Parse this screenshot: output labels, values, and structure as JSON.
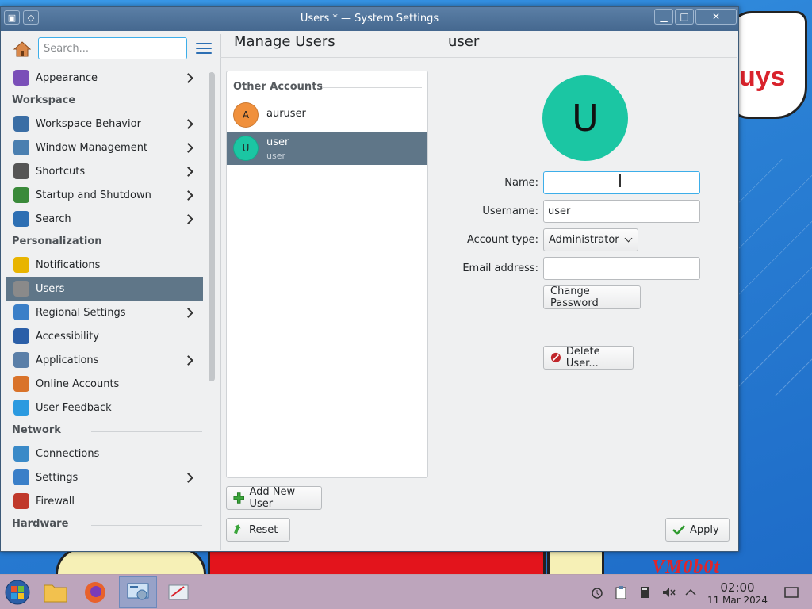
{
  "window": {
    "title": "Users * — System Settings",
    "controls": {
      "minimize": "▁",
      "maximize": "□",
      "close": "✕"
    }
  },
  "sidebar": {
    "search_placeholder": "Search...",
    "top_item": {
      "label": "Appearance",
      "has_children": true
    },
    "categories": [
      {
        "title": "Workspace",
        "items": [
          {
            "label": "Workspace Behavior",
            "has_children": true
          },
          {
            "label": "Window Management",
            "has_children": true
          },
          {
            "label": "Shortcuts",
            "has_children": true
          },
          {
            "label": "Startup and Shutdown",
            "has_children": true
          },
          {
            "label": "Search",
            "has_children": true
          }
        ]
      },
      {
        "title": "Personalization",
        "items": [
          {
            "label": "Notifications",
            "has_children": false
          },
          {
            "label": "Users",
            "has_children": false,
            "selected": true
          },
          {
            "label": "Regional Settings",
            "has_children": true
          },
          {
            "label": "Accessibility",
            "has_children": false
          },
          {
            "label": "Applications",
            "has_children": true
          },
          {
            "label": "Online Accounts",
            "has_children": false
          },
          {
            "label": "User Feedback",
            "has_children": false
          }
        ]
      },
      {
        "title": "Network",
        "items": [
          {
            "label": "Connections",
            "has_children": false
          },
          {
            "label": "Settings",
            "has_children": true
          },
          {
            "label": "Firewall",
            "has_children": false
          }
        ]
      },
      {
        "title": "Hardware",
        "items": []
      }
    ]
  },
  "main": {
    "title": "Manage Users",
    "current_user_header": "user",
    "accounts_header": "Other Accounts",
    "accounts": [
      {
        "initial": "A",
        "name": "auruser",
        "subtitle": "",
        "color": "#f0903c"
      },
      {
        "initial": "U",
        "name": "user",
        "subtitle": "user",
        "color": "#1bc6a3",
        "selected": true
      }
    ],
    "add_user_button": "Add New User",
    "reset_button": "Reset",
    "apply_button": "Apply"
  },
  "user_form": {
    "avatar_initial": "U",
    "name_label": "Name:",
    "name_value": "",
    "username_label": "Username:",
    "username_value": "user",
    "account_type_label": "Account type:",
    "account_type_value": "Administrator",
    "email_label": "Email address:",
    "email_value": "",
    "change_password_button": "Change Password",
    "delete_user_button": "Delete User..."
  },
  "desktop": {
    "bubble_text": "uys",
    "watermark": "VM0b0t"
  },
  "taskbar": {
    "apps": [
      "start-menu",
      "file-manager",
      "firefox",
      "system-settings",
      "text-editor"
    ],
    "clock_time": "02:00",
    "clock_date": "11 Mar 2024"
  }
}
